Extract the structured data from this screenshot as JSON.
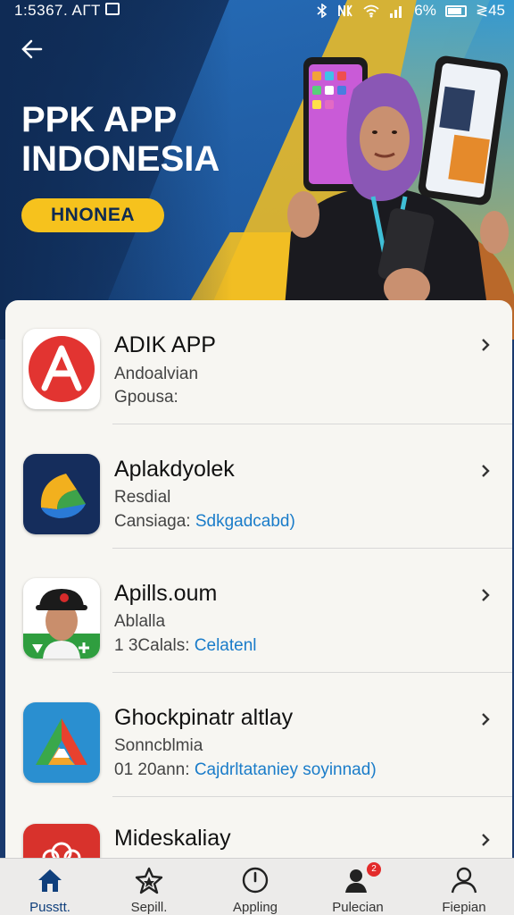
{
  "status_bar": {
    "time": "1:5367. AГT",
    "battery": "6%",
    "extra": "≷45"
  },
  "hero": {
    "title": "PPK APP INDONESIA",
    "badge": "HNONEA"
  },
  "apps": [
    {
      "name": "ADIK APP",
      "sub": "Andoalvian",
      "meta_prefix": "Gpousa:",
      "meta_link": ""
    },
    {
      "name": "Aplakdyolek",
      "sub": "Resdial",
      "meta_prefix": "Cansiaga:",
      "meta_link": "Sdkgadcabd)"
    },
    {
      "name": "Apills.oum",
      "sub": "Ablalla",
      "meta_prefix": "1 3Calals:",
      "meta_link": "Celatenl"
    },
    {
      "name": "Ghockpinatr altlay",
      "sub": "Sonncblmia",
      "meta_prefix": "01 20ann:",
      "meta_link": "Cajdrltataniey soyinnad)"
    },
    {
      "name": "Mideskaliay",
      "sub": "",
      "meta_prefix": "",
      "meta_link": ""
    }
  ],
  "nav": [
    {
      "label": "Pusstt.",
      "icon": "home-icon",
      "active": true
    },
    {
      "label": "Sepill.",
      "icon": "star-icon",
      "active": false
    },
    {
      "label": "Appling",
      "icon": "clock-icon",
      "active": false
    },
    {
      "label": "Pulecian",
      "icon": "user-notification-icon",
      "active": false,
      "badge": "2"
    },
    {
      "label": "Fiepian",
      "icon": "person-icon",
      "active": false
    }
  ],
  "colors": {
    "accent_yellow": "#f6c21d",
    "hero_blue": "#173f75",
    "link_blue": "#1a7cc9"
  }
}
